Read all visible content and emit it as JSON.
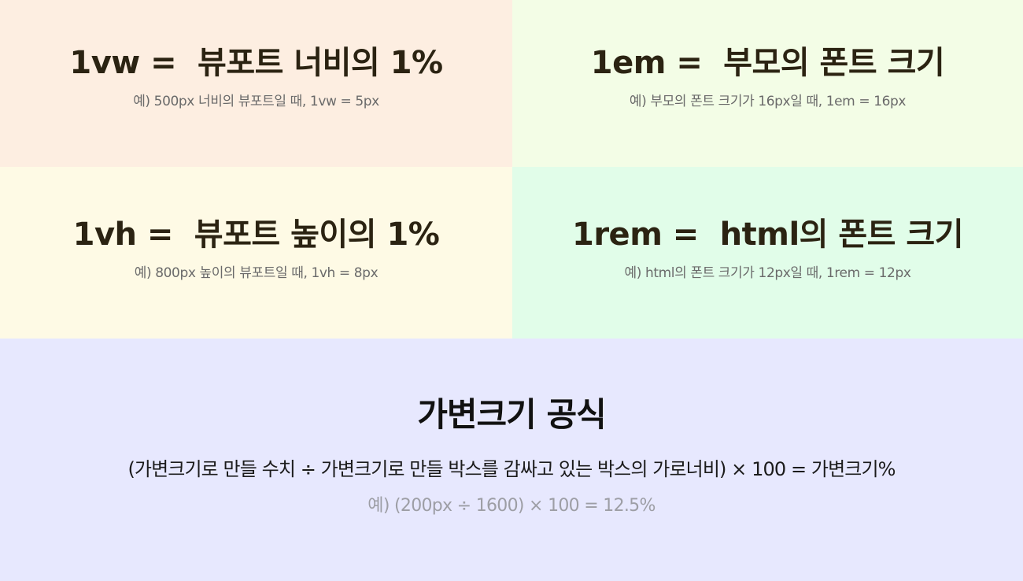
{
  "panels": {
    "vw": {
      "title": "1vw =  뷰포트 너비의 1%",
      "example": "예) 500px 너비의 뷰포트일 때, 1vw = 5px",
      "background": "#fdeee1"
    },
    "em": {
      "title": "1em =  부모의 폰트 크기",
      "example": "예) 부모의 폰트 크기가 16px일 때, 1em = 16px",
      "background": "#f3fde6"
    },
    "vh": {
      "title": "1vh =  뷰포트 높이의 1%",
      "example": "예) 800px 높이의 뷰포트일 때, 1vh = 8px",
      "background": "#fefae5"
    },
    "rem": {
      "title": "1rem =  html의 폰트 크기",
      "example": "예) html의 폰트 크기가 12px일 때, 1rem = 12px",
      "background": "#e1fde9"
    }
  },
  "formula": {
    "title": "가변크기 공식",
    "expression": "(가변크기로 만들 수치 ÷ 가변크기로 만들 박스를 감싸고 있는 박스의 가로너비) × 100 = 가변크기%",
    "example": "예) (200px ÷ 1600) × 100 = 12.5%",
    "background": "#e7e8fe"
  },
  "colors": {
    "title_text": "#2b2312",
    "example_text": "#6a6a6a",
    "formula_example_text": "#9d9ea5"
  }
}
